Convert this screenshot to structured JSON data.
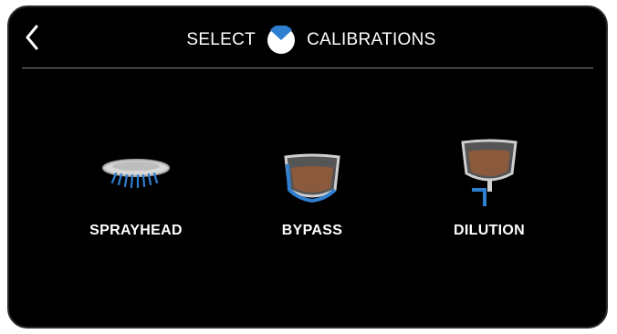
{
  "header": {
    "back_icon": "chevron-left-icon",
    "title_left": "SELECT",
    "title_right": "CALIBRATIONS",
    "logo_icon": "brand-logo-icon"
  },
  "options": [
    {
      "label": "SPRAYHEAD",
      "icon": "sprayhead-icon"
    },
    {
      "label": "BYPASS",
      "icon": "bypass-funnel-icon"
    },
    {
      "label": "DILUTION",
      "icon": "dilution-funnel-icon"
    }
  ],
  "colors": {
    "background": "#000000",
    "text": "#ffffff",
    "accent_blue": "#2f7fd0",
    "coffee": "#8b5a3c",
    "funnel_rim": "#cfcfcf",
    "divider": "#8a8a8a"
  }
}
